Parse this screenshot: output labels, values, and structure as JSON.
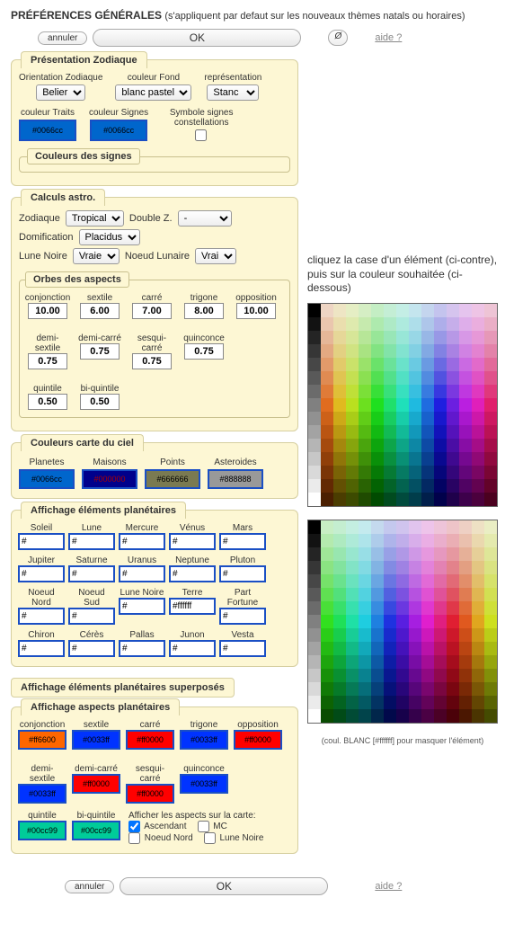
{
  "title": "PRÉFÉRENCES GÉNÉRALES",
  "subtitle": "(s'appliquent par defaut sur les nouveaux thèmes natals ou horaires)",
  "toolbar": {
    "cancel": "annuler",
    "ok": "OK",
    "slash": "Ø",
    "help": "aide ?"
  },
  "zod": {
    "legend": "Présentation Zodiaque",
    "orient_lbl": "Orientation Zodiaque",
    "orient_val": "Belier",
    "bg_lbl": "couleur Fond",
    "bg_val": "blanc pastel",
    "repr_lbl": "représentation",
    "repr_val": "Stanc",
    "traits_lbl": "couleur Traits",
    "traits_val": "#0066cc",
    "signs_lbl": "couleur Signes",
    "signs_val": "#0066cc",
    "sym_lbl": "Symbole signes constellations",
    "sub_legend": "Couleurs des signes"
  },
  "calc": {
    "legend": "Calculs astro.",
    "zod_lbl": "Zodiaque",
    "zod_val": "Tropical",
    "dz_lbl": "Double Z.",
    "dz_val": "-",
    "dom_lbl": "Domification",
    "dom_val": "Placidus",
    "ln_lbl": "Lune Noire",
    "ln_val": "Vraie",
    "nl_lbl": "Noeud Lunaire",
    "nl_val": "Vrai",
    "orbs_legend": "Orbes des aspects",
    "orbs": [
      {
        "n": "conjonction",
        "v": "10.00"
      },
      {
        "n": "sextile",
        "v": "6.00"
      },
      {
        "n": "carré",
        "v": "7.00"
      },
      {
        "n": "trigone",
        "v": "8.00"
      },
      {
        "n": "opposition",
        "v": "10.00"
      },
      {
        "n": "demi-sextile",
        "v": "0.75"
      },
      {
        "n": "demi-carré",
        "v": "0.75"
      },
      {
        "n": "sesqui-carré",
        "v": "0.75"
      },
      {
        "n": "quinconce",
        "v": "0.75"
      },
      {
        "n": "quintile",
        "v": "0.50"
      },
      {
        "n": "bi-quintile",
        "v": "0.50"
      }
    ]
  },
  "sky": {
    "legend": "Couleurs carte du ciel",
    "items": [
      {
        "n": "Planetes",
        "v": "#0066cc",
        "bg": "#0066cc",
        "fg": "#000"
      },
      {
        "n": "Maisons",
        "v": "#000000",
        "bg": "#00008b",
        "fg": "#a00"
      },
      {
        "n": "Points",
        "v": "#666666",
        "bg": "#7a7a52",
        "fg": "#000"
      },
      {
        "n": "Asteroides",
        "v": "#888888",
        "bg": "#999",
        "fg": "#000"
      }
    ]
  },
  "planets": {
    "legend": "Affichage éléments planétaires",
    "items": [
      {
        "n": "Soleil",
        "v": "#"
      },
      {
        "n": "Lune",
        "v": "#"
      },
      {
        "n": "Mercure",
        "v": "#"
      },
      {
        "n": "Vénus",
        "v": "#"
      },
      {
        "n": "Mars",
        "v": "#"
      },
      {
        "n": "Jupiter",
        "v": "#"
      },
      {
        "n": "Saturne",
        "v": "#"
      },
      {
        "n": "Uranus",
        "v": "#"
      },
      {
        "n": "Neptune",
        "v": "#"
      },
      {
        "n": "Pluton",
        "v": "#"
      },
      {
        "n": "Noeud Nord",
        "v": "#"
      },
      {
        "n": "Noeud Sud",
        "v": "#"
      },
      {
        "n": "Lune Noire",
        "v": "#"
      },
      {
        "n": "Terre",
        "v": "#ffffff"
      },
      {
        "n": "Part Fortune",
        "v": "#"
      },
      {
        "n": "Chiron",
        "v": "#"
      },
      {
        "n": "Cérès",
        "v": "#"
      },
      {
        "n": "Pallas",
        "v": "#"
      },
      {
        "n": "Junon",
        "v": "#"
      },
      {
        "n": "Vesta",
        "v": "#"
      }
    ]
  },
  "superposed_legend": "Affichage éléments planétaires superposés",
  "aspects": {
    "legend": "Affichage aspects planétaires",
    "items": [
      {
        "n": "conjonction",
        "v": "#ff6600",
        "bg": "#ff6600"
      },
      {
        "n": "sextile",
        "v": "#0033ff",
        "bg": "#0033ff"
      },
      {
        "n": "carré",
        "v": "#ff0000",
        "bg": "#ff0000"
      },
      {
        "n": "trigone",
        "v": "#0033ff",
        "bg": "#0033ff"
      },
      {
        "n": "opposition",
        "v": "#ff0000",
        "bg": "#ff0000"
      },
      {
        "n": "demi-sextile",
        "v": "#0033ff",
        "bg": "#0033ff"
      },
      {
        "n": "demi-carré",
        "v": "#ff0000",
        "bg": "#ff0000"
      },
      {
        "n": "sesqui-carré",
        "v": "#ff0000",
        "bg": "#ff0000"
      },
      {
        "n": "quinconce",
        "v": "#0033ff",
        "bg": "#0033ff"
      },
      {
        "n": "quintile",
        "v": "#00cc99",
        "bg": "#00cc99"
      },
      {
        "n": "bi-quintile",
        "v": "#00cc99",
        "bg": "#00cc99"
      }
    ],
    "show_lbl": "Afficher les aspects sur la carte:",
    "checks": [
      {
        "n": "Ascendant",
        "c": true
      },
      {
        "n": "MC",
        "c": false
      },
      {
        "n": "Noeud Nord",
        "c": false
      },
      {
        "n": "Lune Noire",
        "c": false
      }
    ]
  },
  "right": {
    "instr": "cliquez la case d'un élément (ci-contre), puis sur la couleur souhaitée (ci-dessous)",
    "note": "(coul. BLANC [#ffffff] pour masquer l'élément)"
  }
}
